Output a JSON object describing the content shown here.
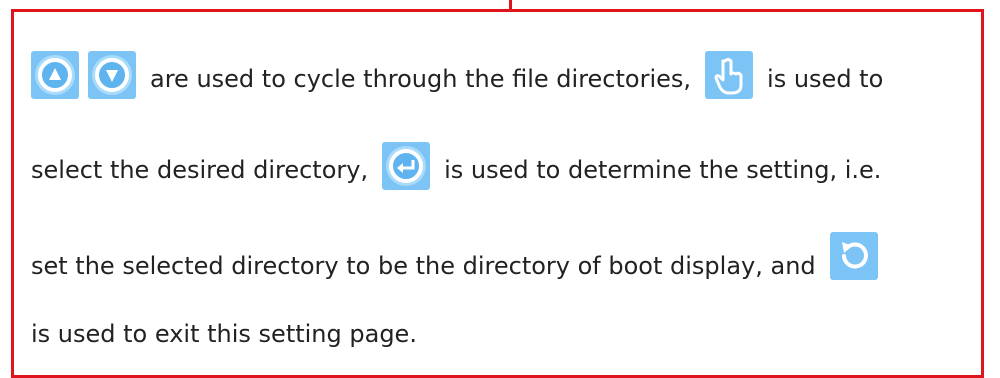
{
  "icons": {
    "up": "up-arrow-icon",
    "down": "down-arrow-icon",
    "select": "hand-pointer-icon",
    "confirm": "enter-icon",
    "exit": "return-icon"
  },
  "colors": {
    "border": "#e0141c",
    "icon_bg": "#7cc4f5",
    "text": "#222222"
  },
  "text": {
    "line1": "are used to cycle through the file directories,",
    "line1_tail": "is used to",
    "line2_head": "select the desired directory,",
    "line2_tail": "is used to determine the setting, i.e.",
    "line3": "set the selected directory to be the directory of boot display, and",
    "line4": "is used to exit this setting page."
  }
}
